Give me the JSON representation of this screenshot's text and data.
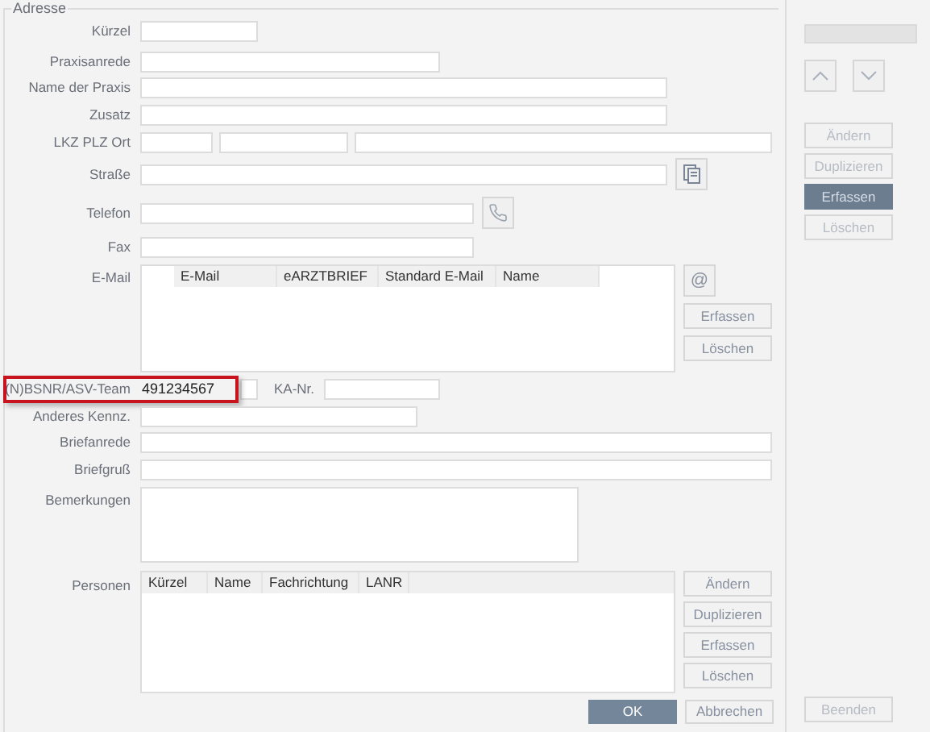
{
  "group_title": "Adresse",
  "kuerzel": {
    "label": "Kürzel"
  },
  "praxisanrede": {
    "label": "Praxisanrede"
  },
  "name_der_praxis": {
    "label": "Name der Praxis"
  },
  "zusatz": {
    "label": "Zusatz"
  },
  "lkz_plz_ort": {
    "label": "LKZ PLZ Ort"
  },
  "strasse": {
    "label": "Straße"
  },
  "telefon": {
    "label": "Telefon"
  },
  "fax": {
    "label": "Fax"
  },
  "email": {
    "label": "E-Mail",
    "icon_button": "@",
    "columns": [
      "E-Mail",
      "eARZTBRIEF",
      "Standard E-Mail",
      "Name"
    ],
    "buttons": [
      "Erfassen",
      "Löschen"
    ]
  },
  "bsnr": {
    "label": "(N)BSNR/ASV-Team",
    "value": "491234567",
    "highlighted": true
  },
  "ka_nr": {
    "label": "KA-Nr."
  },
  "anderes_kennz": {
    "label": "Anderes Kennz."
  },
  "briefanrede": {
    "label": "Briefanrede"
  },
  "briefgruss": {
    "label": "Briefgruß"
  },
  "bemerkungen": {
    "label": "Bemerkungen"
  },
  "personen": {
    "label": "Personen",
    "columns": [
      "Kürzel",
      "Name",
      "Fachrichtung",
      "LANR"
    ],
    "buttons": [
      "Ändern",
      "Duplizieren",
      "Erfassen",
      "Löschen"
    ]
  },
  "footer_buttons": [
    {
      "label": "OK",
      "primary": true
    },
    {
      "label": "Abbrechen",
      "primary": false
    }
  ],
  "side_buttons": [
    {
      "label": "Ändern",
      "selected": false,
      "disabled": true
    },
    {
      "label": "Duplizieren",
      "selected": false,
      "disabled": true
    },
    {
      "label": "Erfassen",
      "selected": true,
      "disabled": false
    },
    {
      "label": "Löschen",
      "selected": false,
      "disabled": true
    }
  ],
  "exit_button": {
    "label": "Beenden",
    "disabled": true
  }
}
